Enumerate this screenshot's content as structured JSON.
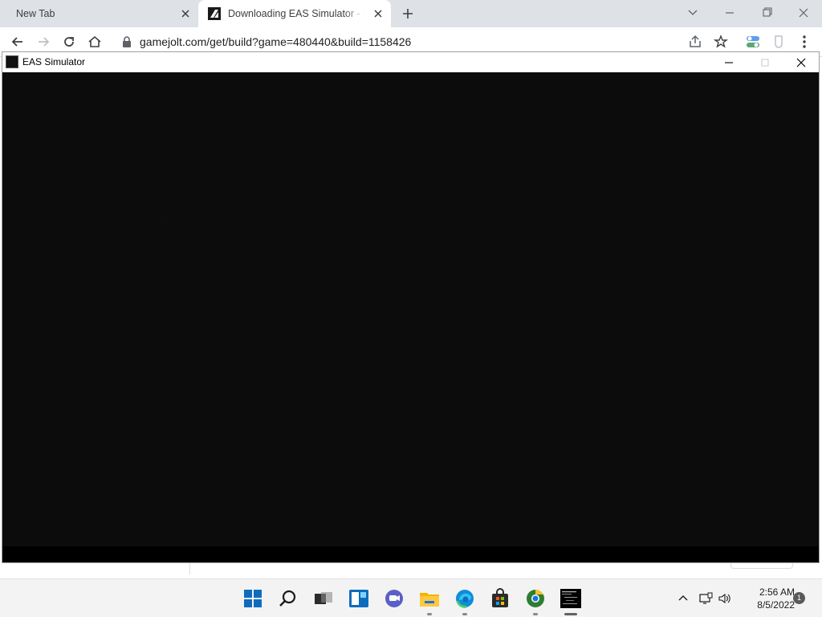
{
  "browser": {
    "tabs": [
      {
        "title": "New Tab",
        "active": false
      },
      {
        "title": "Downloading EAS Simulator - Game Jolt",
        "active": true
      }
    ],
    "url": "gamejolt.com/get/build?game=480440&build=1158426"
  },
  "game_window": {
    "title": "EAS Simulator"
  },
  "taskbar": {
    "apps": [
      "start-icon",
      "search-icon",
      "task-view-icon",
      "widgets-icon",
      "chat-icon",
      "file-explorer-icon",
      "edge-icon",
      "store-icon",
      "chrome-canary-icon",
      "eas-simulator-icon"
    ],
    "clock": {
      "time": "2:56 AM",
      "date": "8/5/2022"
    },
    "notifications": "1"
  },
  "colors": {
    "chrome_tabstrip": "#dee1e6",
    "window_bg": "#0c0c0c",
    "taskbar": "#f3f3f3"
  }
}
